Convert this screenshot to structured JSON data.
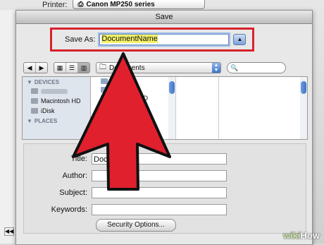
{
  "background": {
    "printer_label": "Printer:",
    "printer_value": "Canon MP250 series"
  },
  "dialog": {
    "title": "Save",
    "save_as_label": "Save As:",
    "save_as_value": "DocumentName",
    "expand_button": "▲"
  },
  "toolbar": {
    "current_folder": "Documents",
    "search_placeholder": ""
  },
  "sidebar": {
    "devices_header": "DEVICES",
    "items": [
      "Macintosh HD",
      "iDisk"
    ],
    "places_header": "PLACES"
  },
  "file_columns": {
    "col1": [
      "1 ...p",
      "...NCE",
      "...ASE READ",
      "...e"
    ]
  },
  "properties": {
    "title_label": "Title:",
    "title_value": "Docu",
    "author_label": "Author:",
    "subject_label": "Subject:",
    "keywords_label": "Keywords:",
    "security_button": "Security Options..."
  },
  "colors": {
    "highlight_border": "#d8232a",
    "arrow_fill": "#e1202d",
    "selection_highlight": "#f4f26a"
  },
  "watermark": {
    "wiki": "wiki",
    "how": "How"
  }
}
